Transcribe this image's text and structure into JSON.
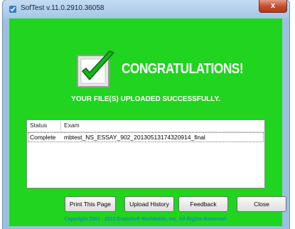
{
  "window": {
    "title": "SofTest v.11.0.2910.36058",
    "close_label": "x"
  },
  "banner": {
    "heading": "CONGRATULATIONS!",
    "subtitle": "YOUR FILE(S) UPLOADED SUCCESSFULLY."
  },
  "table": {
    "columns": [
      "Status",
      "Exam"
    ],
    "rows": [
      {
        "status": "Complete",
        "exam": "mbtest_NS_ESSAY_902_20130513174320914_final"
      }
    ]
  },
  "buttons": {
    "print": "Print This Page",
    "history": "Upload History",
    "feedback": "Feedback",
    "close": "Close"
  },
  "footer": {
    "copyright": "Copyright 2001 - 2013 ExamSoft Worldwide, Inc. All Rights Reserved."
  },
  "colors": {
    "panel_green": "#20d420",
    "copyright_blue": "#1a85c8"
  }
}
